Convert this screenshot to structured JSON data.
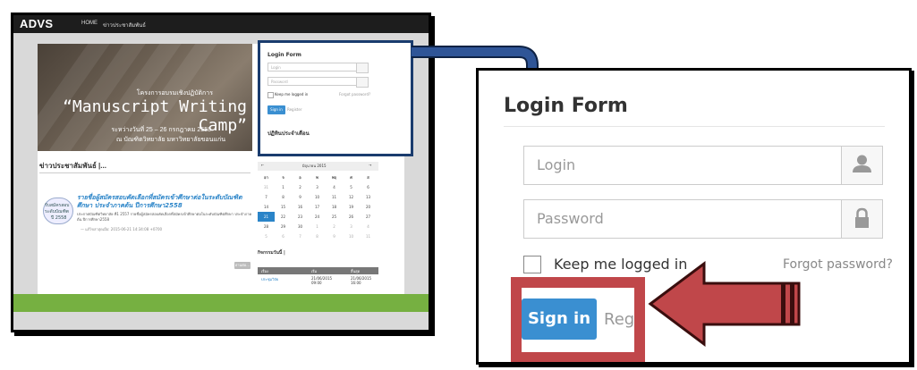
{
  "thumbnail": {
    "brand": "ADVS",
    "nav": [
      "HOME",
      "ข่าวประชาสัมพันธ์"
    ],
    "banner": {
      "line1": "โครงการอบรมเชิงปฏิบัติการ",
      "line2": "“Manuscript Writing Camp”",
      "line3": "ระหว่างวันที่ 25 – 26 กรกฎาคม 2558",
      "line4": "ณ บัณฑิตวิทยาลัย มหาวิทยาลัยขอนแก่น"
    },
    "news_title": "ข่าวประชาสัมพันธ์ |...",
    "news_item": {
      "badge_line1": "รับสมัครสอบ",
      "badge_line2": "ระดับบัณฑิต",
      "badge_line3": "ปี 2558",
      "headline": "รายชื่อผู้สมัครสอบคัดเลือกที่สมัครเข้าศึกษาต่อในระดับบัณฑิตศึกษา ประจำภาคต้น ปีการศึกษา2558",
      "body": "ประกาศบัณฑิตวิทยาลัย ที่1 2557 รายชื่อผู้สมัครสอบคัดเลือกที่สมัครเข้าศึกษาต่อในระดับบัณฑิตศึกษา ประจำภาคต้น ปีการศึกษา2558",
      "meta": "— แก้ไขล่าสุดเมื่อ: 2015-06-21 14:34:08 +0700"
    },
    "more_button": "อ่านต่อ...",
    "mini_login": {
      "title": "Login Form",
      "login_placeholder": "Login",
      "password_placeholder": "Password",
      "keep_label": "Keep me logged in",
      "forgot_label": "Forgot password?",
      "signin_label": "Sign in",
      "register_label": "Register",
      "calendar_title": "ปฏิทินประจำเดือน"
    },
    "calendar": {
      "prev": "←",
      "next": "→",
      "month": "มิถุนายน 2015",
      "weekdays": [
        "อา",
        "จ",
        "อ",
        "พ",
        "พฤ",
        "ศ",
        "ส"
      ],
      "weeks": [
        [
          "31",
          "1",
          "2",
          "3",
          "4",
          "5",
          "6"
        ],
        [
          "7",
          "8",
          "9",
          "10",
          "11",
          "12",
          "13"
        ],
        [
          "14",
          "15",
          "16",
          "17",
          "18",
          "19",
          "20"
        ],
        [
          "21",
          "22",
          "23",
          "24",
          "25",
          "26",
          "27"
        ],
        [
          "28",
          "29",
          "30",
          "1",
          "2",
          "3",
          "4"
        ],
        [
          "5",
          "6",
          "7",
          "8",
          "9",
          "10",
          "11"
        ]
      ],
      "today": "21"
    },
    "activities": {
      "title": "กิจกรรมวันนี้ |",
      "headers": [
        "เรื่อง",
        "เริ่ม",
        "สิ้นสุด"
      ],
      "row": [
        "ประชุมวิจัย",
        "21/06/2015 09:00",
        "21/06/2015 16:00"
      ]
    }
  },
  "login_form": {
    "title": "Login Form",
    "login_placeholder": "Login",
    "password_placeholder": "Password",
    "keep_label": "Keep me logged in",
    "forgot_label": "Forgot password?",
    "signin_label": "Sign in",
    "register_label": "Regi"
  },
  "colors": {
    "navy_arrow": "#1f3c6e",
    "red_arrow": "#c0474a",
    "sign_in_blue": "#3a8fd1",
    "green_footer": "#76b041"
  },
  "icons": {
    "login_field": "user-icon",
    "password_field": "lock-icon",
    "connector": "curved-arrow-icon",
    "pointer": "left-arrow-icon"
  }
}
